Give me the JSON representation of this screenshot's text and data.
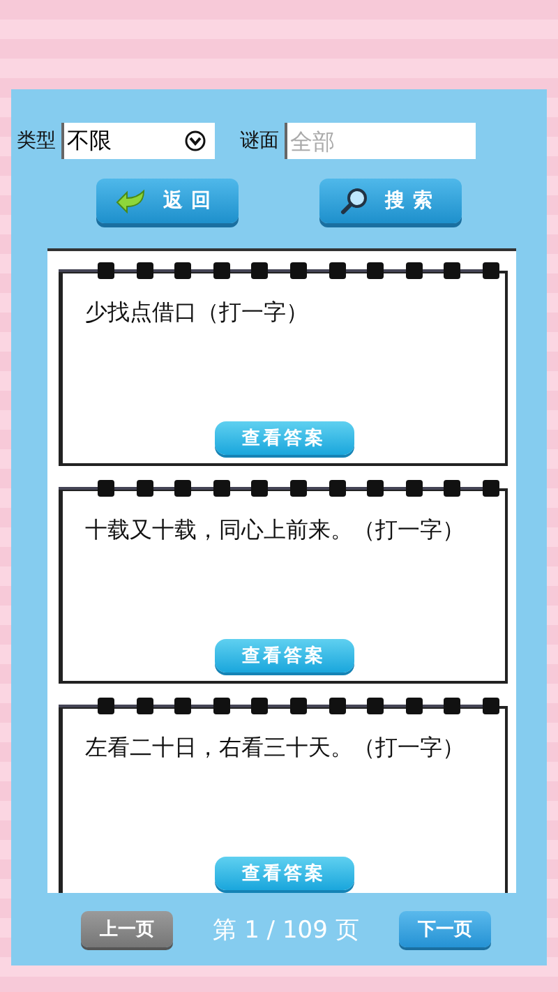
{
  "filters": {
    "type_label": "类型",
    "type_value": "不限",
    "riddle_label": "谜面",
    "riddle_placeholder": "全部"
  },
  "buttons": [
    {
      "kind": "back",
      "label": "返回"
    },
    {
      "kind": "search",
      "label": "搜索"
    }
  ],
  "riddles": [
    {
      "question": "少找点借口（打一字）",
      "answer_button": "查看答案"
    },
    {
      "question": "十载又十载，同心上前来。（打一字）",
      "answer_button": "查看答案"
    },
    {
      "question": "左看二十日，右看三十天。（打一字）",
      "answer_button": "查看答案"
    }
  ],
  "pager": {
    "prev": {
      "label": "上一页",
      "disabled": true
    },
    "page_text": "第 1 / 109 页",
    "next": {
      "label": "下一页",
      "disabled": false
    }
  }
}
